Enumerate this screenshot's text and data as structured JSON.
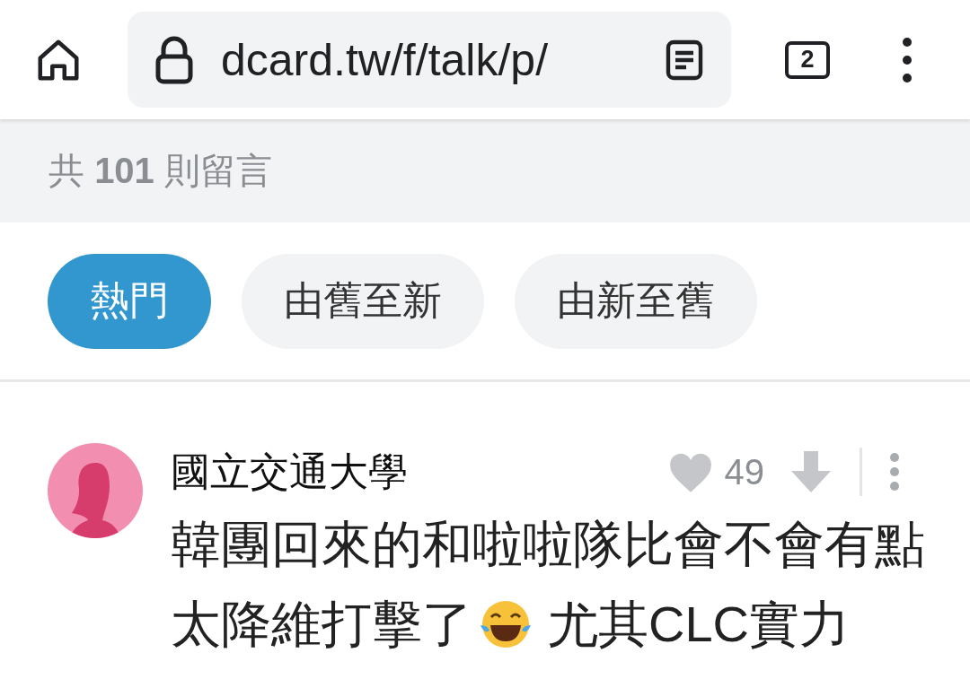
{
  "browser": {
    "url": "dcard.tw/f/talk/p/",
    "tab_count": "2"
  },
  "comments_header": {
    "summary": "共 **101** 則留言"
  },
  "sort_tabs": [
    {
      "label": "熱門",
      "selected": true
    },
    {
      "label": "由舊至新",
      "selected": false
    },
    {
      "label": "由新至舊",
      "selected": false
    }
  ],
  "comment": {
    "author": "國立交通大學",
    "likes": "49",
    "line_1": "韓團回來的和啦啦隊比會不會有點",
    "line_2_before": "太降維打擊了",
    "line_2_after": "尤其CLC實力"
  }
}
